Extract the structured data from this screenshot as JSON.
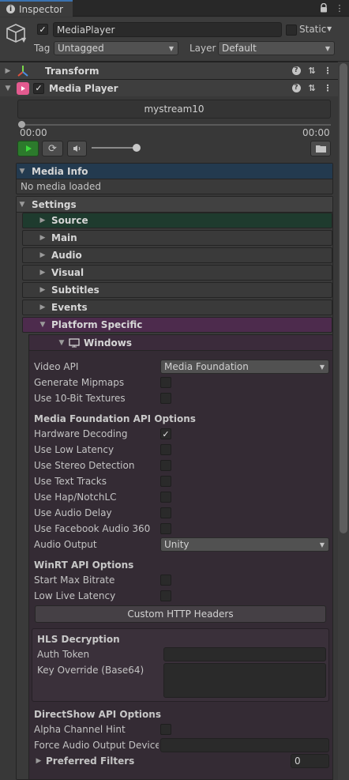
{
  "window": {
    "tab_title": "Inspector"
  },
  "gameobject": {
    "name": "MediaPlayer",
    "static_label": "Static",
    "tag_label": "Tag",
    "tag_value": "Untagged",
    "layer_label": "Layer",
    "layer_value": "Default"
  },
  "components": {
    "transform": "Transform",
    "media_player": "Media Player"
  },
  "player": {
    "stream_name": "mystream10",
    "time_current": "00:00",
    "time_total": "00:00",
    "progress": 0,
    "volume": 0.95
  },
  "sections": {
    "media_info": {
      "title": "Media Info",
      "status": "No media loaded"
    },
    "settings": "Settings",
    "source": "Source",
    "main": "Main",
    "audio": "Audio",
    "visual": "Visual",
    "subtitles": "Subtitles",
    "events": "Events",
    "platform_specific": "Platform Specific",
    "windows": "Windows"
  },
  "windows": {
    "video_api_label": "Video API",
    "video_api_value": "Media Foundation",
    "generate_mipmaps": "Generate Mipmaps",
    "use_10bit": "Use 10-Bit Textures",
    "mf_header": "Media Foundation API Options",
    "hardware_decoding": "Hardware Decoding",
    "low_latency": "Use Low Latency",
    "stereo_detection": "Use Stereo Detection",
    "text_tracks": "Use Text Tracks",
    "hap_notch": "Use Hap/NotchLC",
    "audio_delay": "Use Audio Delay",
    "facebook_audio": "Use Facebook Audio 360",
    "audio_output_label": "Audio Output",
    "audio_output_value": "Unity",
    "winrt_header": "WinRT API Options",
    "start_max_bitrate": "Start Max Bitrate",
    "low_live_latency": "Low Live Latency",
    "custom_http_headers": "Custom HTTP Headers",
    "hls_header": "HLS Decryption",
    "auth_token": "Auth Token",
    "key_override": "Key Override (Base64)",
    "ds_header": "DirectShow API Options",
    "alpha_channel_hint": "Alpha Channel Hint",
    "force_audio_device": "Force Audio Output Device Name",
    "preferred_filters": "Preferred Filters",
    "preferred_filters_count": "0"
  },
  "checks": {
    "hardware_decoding": "✓"
  },
  "colors": {
    "media_info": "#233a4f",
    "source": "#1e3b2e",
    "platform_specific": "#4d2b4d",
    "windows": "#3b2b3b",
    "panel": "#342b34",
    "play": "#2c7a2c"
  },
  "icons": [
    "info-icon",
    "lock-icon",
    "menu-dots-icon",
    "cube-icon",
    "transform-axes-icon",
    "media-player-icon",
    "help-icon",
    "settings-sliders-icon",
    "play-icon",
    "loop-icon",
    "speaker-icon",
    "folder-icon",
    "monitor-icon"
  ]
}
